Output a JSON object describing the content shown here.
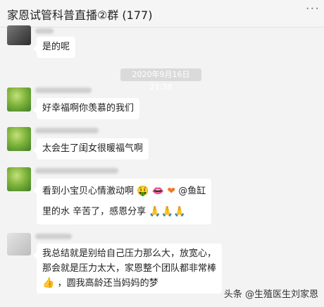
{
  "header": {
    "title": "家恩试管科普直播②群 (177)",
    "more_icon": "more-icon"
  },
  "messages": [
    {
      "text": "是的呢"
    },
    {
      "timestamp": "2020年9月16日 21:38"
    },
    {
      "text": "好幸福啊你羡慕的我们"
    },
    {
      "text": "太会生了闺女很暖福气啊"
    },
    {
      "line1": "看到小宝贝心情激动啊",
      "emoji1": "🤑",
      "emoji2": "👄",
      "emoji3": "❤",
      "mention": "@鱼缸",
      "line2": "里的水 辛苦了，感恩分享",
      "emoji4": "🙏🙏🙏"
    },
    {
      "line1": "我总结就是别给自己压力那么大，放宽心，",
      "line2": "那会就是压力太大，家恩整个团队都非常棒",
      "emoji_thumbs": "👍",
      "line3": "，圆我高龄还当妈妈的梦"
    }
  ],
  "watermark": "头条 @生殖医生刘家恩",
  "colors": {
    "background": "#f3f3f3",
    "bubble": "#ffffff",
    "avatar_green": "#7fb43c"
  }
}
